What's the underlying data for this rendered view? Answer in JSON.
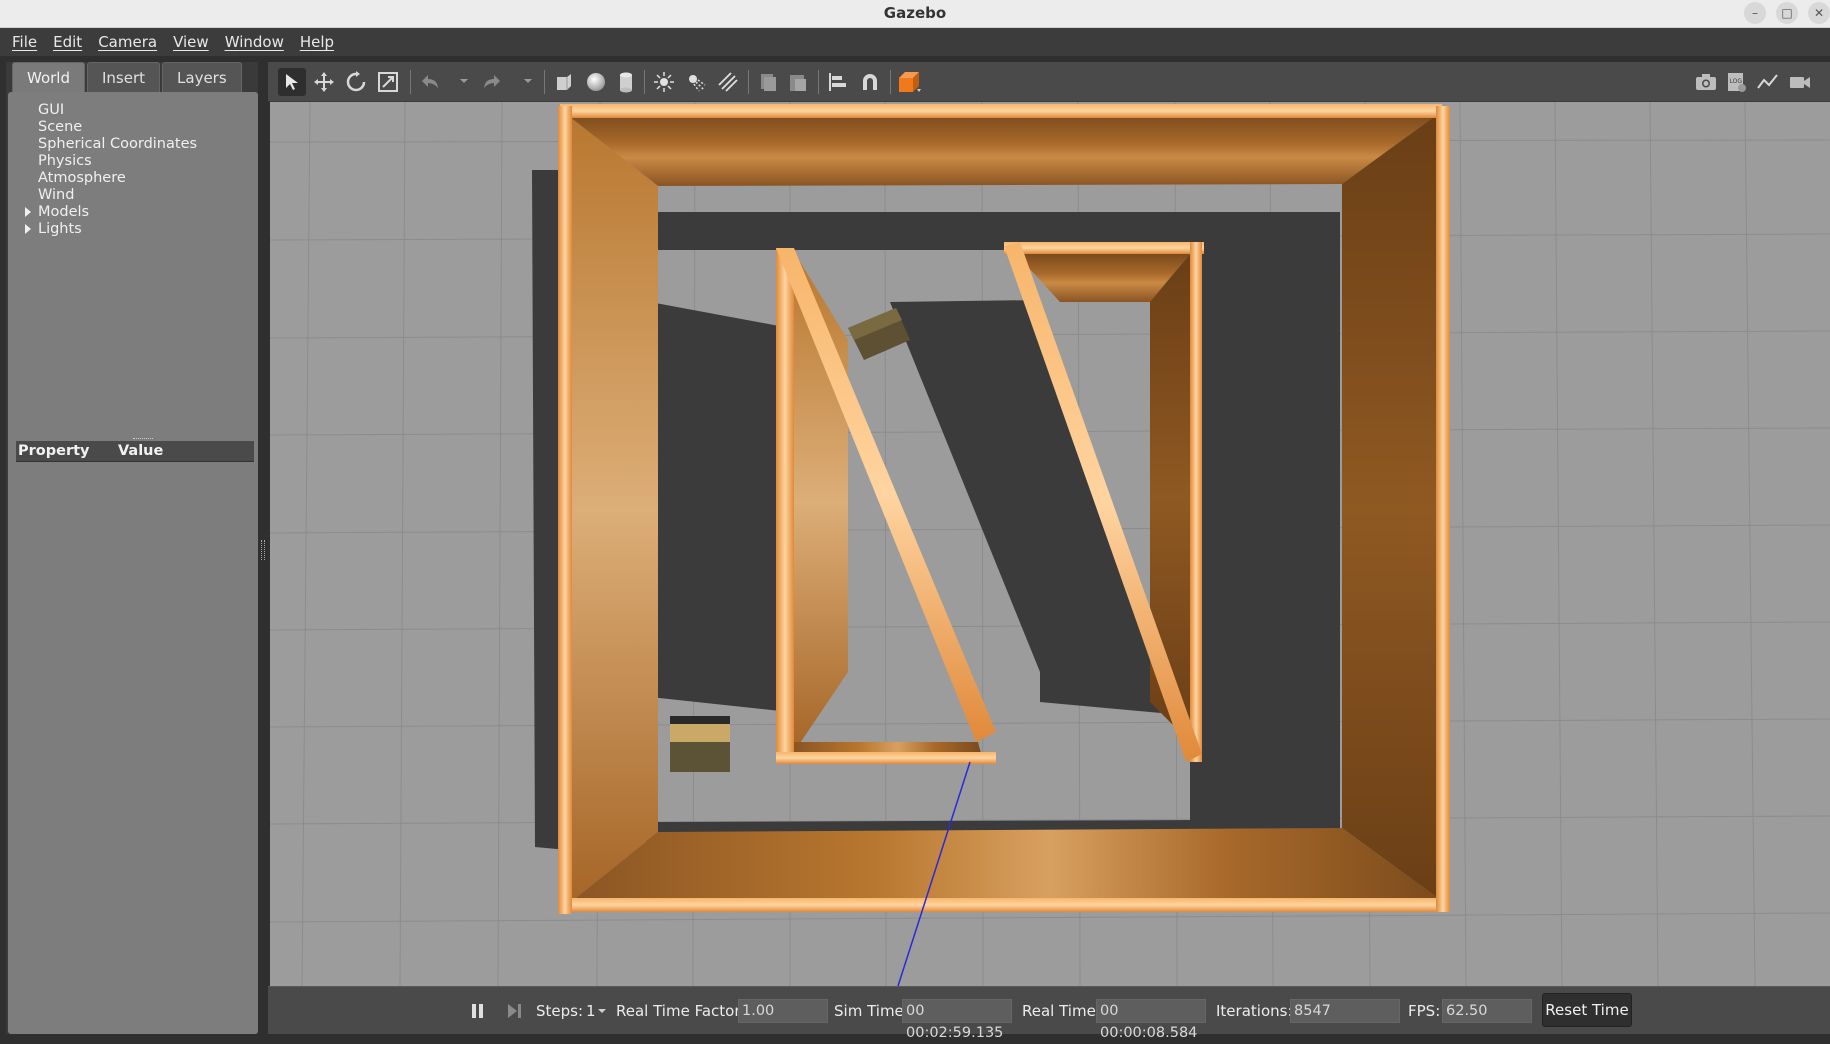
{
  "window": {
    "title": "Gazebo",
    "controls": [
      "minimize-icon",
      "maximize-icon",
      "close-icon"
    ]
  },
  "menubar": [
    "File",
    "Edit",
    "Camera",
    "View",
    "Window",
    "Help"
  ],
  "left_panel": {
    "tabs": [
      "World",
      "Insert",
      "Layers"
    ],
    "active_tab": "World",
    "tree": [
      {
        "label": "GUI",
        "expandable": false
      },
      {
        "label": "Scene",
        "expandable": false
      },
      {
        "label": "Spherical Coordinates",
        "expandable": false
      },
      {
        "label": "Physics",
        "expandable": false
      },
      {
        "label": "Atmosphere",
        "expandable": false
      },
      {
        "label": "Wind",
        "expandable": false
      },
      {
        "label": "Models",
        "expandable": true
      },
      {
        "label": "Lights",
        "expandable": true
      }
    ],
    "property_header": {
      "property": "Property",
      "value": "Value"
    }
  },
  "toolbar": {
    "tools": [
      "select-arrow-icon",
      "translate-icon",
      "rotate-icon",
      "scale-icon",
      "undo-icon",
      "redo-icon",
      "box-icon",
      "sphere-icon",
      "cylinder-icon",
      "point-light-icon",
      "spot-light-icon",
      "directional-light-icon",
      "copy-icon",
      "paste-icon",
      "align-icon",
      "snap-icon",
      "view-angle-icon",
      "screenshot-icon",
      "log-icon",
      "plot-icon",
      "record-video-icon"
    ],
    "active_tool": "select-arrow-icon"
  },
  "bottom_bar": {
    "steps_label": "Steps:",
    "steps_value": "1",
    "rtf_label": "Real Time Factor:",
    "rtf_value": "1.00",
    "sim_time_label": "Sim Time:",
    "sim_time_value": "00 00:02:59.135",
    "real_time_label": "Real Time:",
    "real_time_value": "00 00:00:08.584",
    "iterations_label": "Iterations:",
    "iterations_value": "8547",
    "fps_label": "FPS:",
    "fps_value": "62.50",
    "reset_label": "Reset Time"
  },
  "colors": {
    "wood": "#c9833f",
    "wood_edge": "#f0a050",
    "ground": "#9c9c9c",
    "shadow": "#3b3b3b",
    "grid": "#8a8a8a"
  }
}
